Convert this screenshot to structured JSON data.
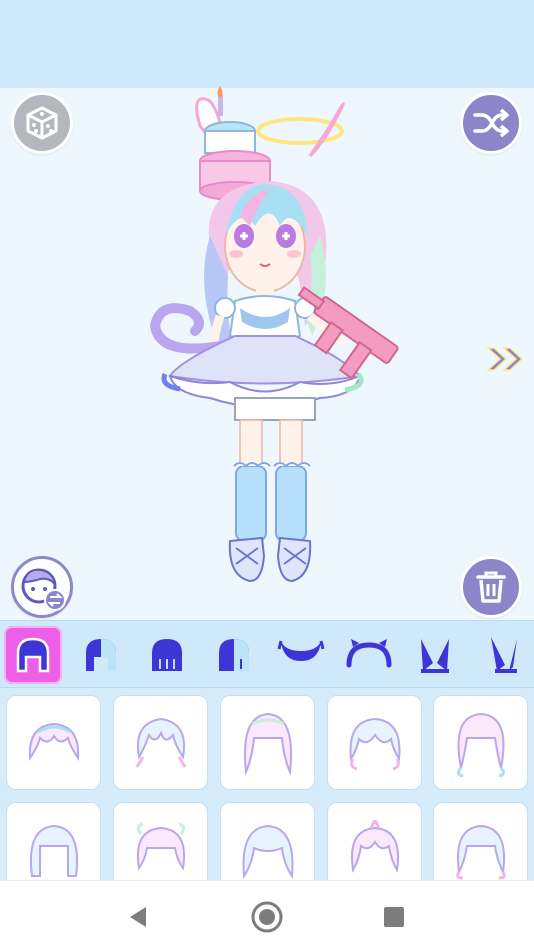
{
  "buttons": {
    "random_part": "dice-icon",
    "shuffle": "shuffle-icon",
    "switch_face": "face-swap-icon",
    "delete": "trash-icon",
    "next_page": "double-chevron-right-icon"
  },
  "categories": [
    {
      "id": "hair-full",
      "icon": "hair-full-icon",
      "selected": true
    },
    {
      "id": "hair-front",
      "icon": "hair-front-icon",
      "selected": false
    },
    {
      "id": "hair-back",
      "icon": "hair-back-icon",
      "selected": false
    },
    {
      "id": "hair-side",
      "icon": "hair-side-icon",
      "selected": false
    },
    {
      "id": "horns",
      "icon": "horns-icon",
      "selected": false
    },
    {
      "id": "headband",
      "icon": "headband-icon",
      "selected": false
    },
    {
      "id": "bunny-ears",
      "icon": "bunny-ears-icon",
      "selected": false
    },
    {
      "id": "long-ears",
      "icon": "long-ears-icon",
      "selected": false
    }
  ],
  "hair_items": [
    {
      "style": "short-bob"
    },
    {
      "style": "messy-short"
    },
    {
      "style": "long-wavy"
    },
    {
      "style": "shaggy"
    },
    {
      "style": "curly-long"
    },
    {
      "style": "straight-bob"
    },
    {
      "style": "spiky-curls"
    },
    {
      "style": "long-straight"
    },
    {
      "style": "tousled"
    },
    {
      "style": "wispy"
    }
  ],
  "colors": {
    "accent_pink": "#ee5fe8",
    "accent_purple": "#8c86c9",
    "panel_blue": "#cfe9fb",
    "icon_indigo": "#3d35d6"
  },
  "nav": {
    "back": "back-icon",
    "home": "home-icon",
    "recents": "recents-icon"
  }
}
